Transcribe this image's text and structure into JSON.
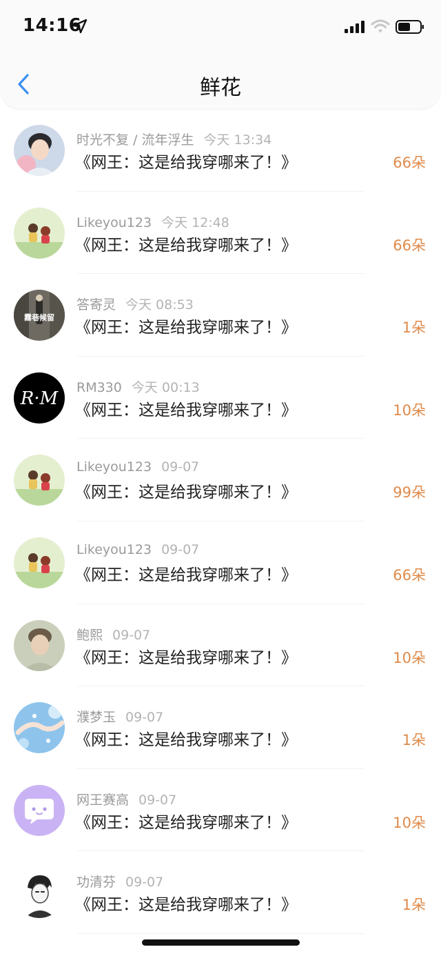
{
  "status": {
    "time": "14:16"
  },
  "nav": {
    "title": "鲜花"
  },
  "rows": [
    {
      "user": "时光不复 / 流年浮生",
      "time": "今天 13:34",
      "book": "《网王：这是给我穿哪来了！》",
      "amount": "66朵",
      "avatar": "boy-portrait"
    },
    {
      "user": "Likeyou123",
      "time": "今天 12:48",
      "book": "《网王：这是给我穿哪来了！》",
      "amount": "66朵",
      "avatar": "cartoon-kids"
    },
    {
      "user": "答寄灵",
      "time": "今天 08:53",
      "book": "《网王：这是给我穿哪来了！》",
      "amount": "1朵",
      "avatar": "alley",
      "avatar_text": "霧巷候留"
    },
    {
      "user": "RM330",
      "time": "今天 00:13",
      "book": "《网王：这是给我穿哪来了！》",
      "amount": "10朵",
      "avatar": "monogram",
      "avatar_text": "R·M"
    },
    {
      "user": "Likeyou123",
      "time": "09-07",
      "book": "《网王：这是给我穿哪来了！》",
      "amount": "99朵",
      "avatar": "cartoon-kids"
    },
    {
      "user": "Likeyou123",
      "time": "09-07",
      "book": "《网王：这是给我穿哪来了！》",
      "amount": "66朵",
      "avatar": "cartoon-kids"
    },
    {
      "user": "鲍熙",
      "time": "09-07",
      "book": "《网王：这是给我穿哪来了！》",
      "amount": "10朵",
      "avatar": "man-portrait"
    },
    {
      "user": "濮梦玉",
      "time": "09-07",
      "book": "《网王：这是给我穿哪来了！》",
      "amount": "1朵",
      "avatar": "hands-water"
    },
    {
      "user": "网王赛高",
      "time": "09-07",
      "book": "《网王：这是给我穿哪来了！》",
      "amount": "10朵",
      "avatar": "chat-bubble"
    },
    {
      "user": "功清芬",
      "time": "09-07",
      "book": "《网王：这是给我穿哪来了！》",
      "amount": "1朵",
      "avatar": "anime-sketch"
    }
  ],
  "colors": {
    "accent_blue": "#3b8ff0",
    "amount_orange": "#e08a4a",
    "avatar_purple": "#c9b3f4"
  }
}
